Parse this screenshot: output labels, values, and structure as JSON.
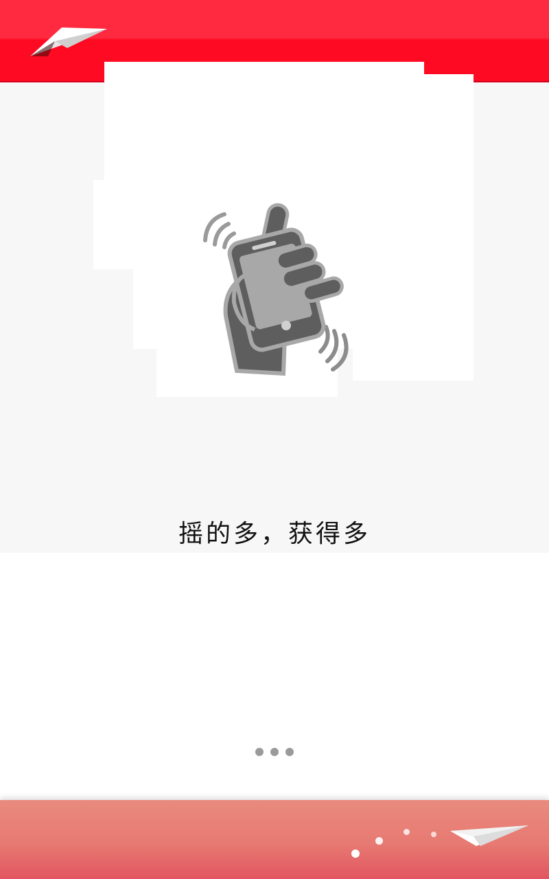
{
  "header": {
    "logo_icon": "paper-plane-icon",
    "color": "#ff1a33"
  },
  "main": {
    "illustration_icon": "shake-phone-icon",
    "tagline": "摇的多，获得多"
  },
  "pager": {
    "count": 3,
    "active_index": 0
  },
  "footer": {
    "decoration_icon": "paper-plane-icon",
    "color": "#e77a72"
  }
}
